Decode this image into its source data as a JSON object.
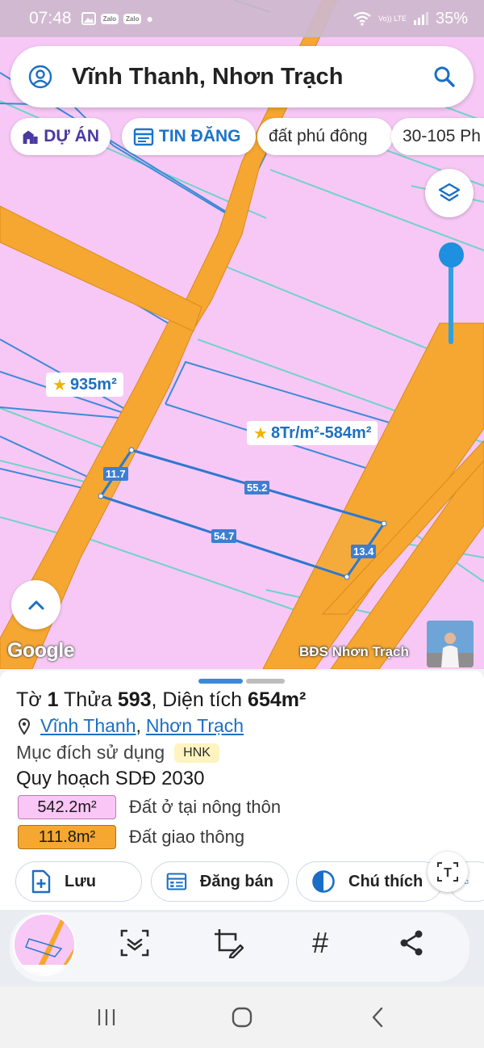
{
  "status_bar": {
    "time": "07:48",
    "notifications": [
      "Zalo",
      "Zalo"
    ],
    "network_label": "Vo)) LTE",
    "battery": "35%"
  },
  "search": {
    "query": "Vĩnh Thanh, Nhơn Trạch",
    "icons": [
      "user-circle-icon",
      "search-icon"
    ]
  },
  "chips": [
    {
      "label": "DỰ ÁN",
      "icon": "building-icon"
    },
    {
      "label": "TIN ĐĂNG",
      "icon": "calendar-list-icon"
    },
    {
      "label": "đất phú đông"
    },
    {
      "label": "30-105 Ph"
    }
  ],
  "map": {
    "tags": [
      {
        "label": "935m²",
        "icon": "star-icon"
      },
      {
        "label": "8Tr/m²-584m²",
        "icon": "star-icon"
      }
    ],
    "measurements": [
      "11.7",
      "55.2",
      "54.7",
      "13.4"
    ],
    "google_logo": "Google",
    "watermark": "BĐS Nhơn Trạch",
    "colors": {
      "residential": "#f7c8f5",
      "road": "#f5a732",
      "parcel_line": "#3b8ad8",
      "grid_line": "#6fd3c8"
    }
  },
  "sheet": {
    "title": {
      "to_label": "Tờ",
      "to_value": "1",
      "thua_label": "Thửa",
      "thua_value": "593",
      "area_label": ", Diện tích",
      "area_value": "654m²"
    },
    "location": {
      "commune": "Vĩnh Thanh",
      "separator": ",",
      "district": "Nhơn Trạch"
    },
    "purpose_label": "Mục đích sử dụng",
    "purpose_code": "HNK",
    "plan_title": "Quy hoạch SDĐ 2030",
    "areas": [
      {
        "value": "542.2m²",
        "label": "Đất ở tại nông thôn",
        "color": "#f9c6f6"
      },
      {
        "value": "111.8m²",
        "label": "Đất giao thông",
        "color": "#f5a732"
      }
    ],
    "actions": [
      {
        "label": "Lưu",
        "icon": "add-doc-icon"
      },
      {
        "label": "Đăng bán",
        "icon": "listing-icon"
      },
      {
        "label": "Chú thích",
        "icon": "half-circle-icon"
      }
    ],
    "text_button": "T"
  },
  "toolbar": {
    "hashtag": "#",
    "icons": [
      "screenshot-thumbnail",
      "scan-text-icon",
      "edit-crop-icon",
      "hashtag-icon",
      "share-icon"
    ]
  },
  "navbar": {
    "icons": [
      "recents-icon",
      "home-icon",
      "back-icon"
    ]
  }
}
